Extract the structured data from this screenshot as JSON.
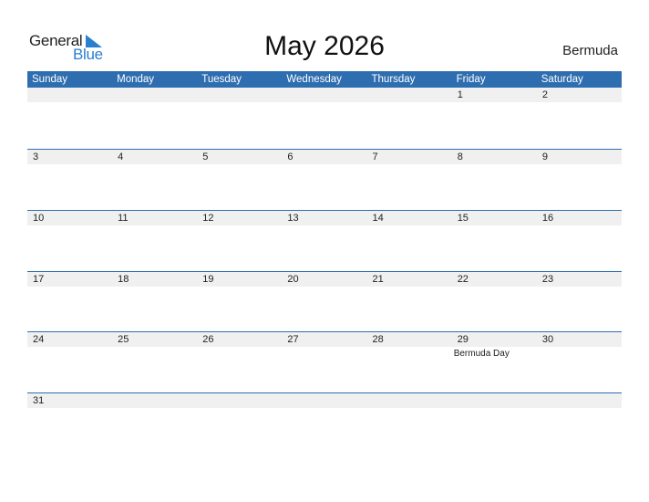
{
  "logo": {
    "line1": "General",
    "line2": "Blue"
  },
  "title": "May 2026",
  "country": "Bermuda",
  "weekdays": [
    "Sunday",
    "Monday",
    "Tuesday",
    "Wednesday",
    "Thursday",
    "Friday",
    "Saturday"
  ],
  "weeks": [
    [
      "",
      "",
      "",
      "",
      "",
      "1",
      "2"
    ],
    [
      "3",
      "4",
      "5",
      "6",
      "7",
      "8",
      "9"
    ],
    [
      "10",
      "11",
      "12",
      "13",
      "14",
      "15",
      "16"
    ],
    [
      "17",
      "18",
      "19",
      "20",
      "21",
      "22",
      "23"
    ],
    [
      "24",
      "25",
      "26",
      "27",
      "28",
      "29",
      "30"
    ],
    [
      "31",
      "",
      "",
      "",
      "",
      "",
      ""
    ]
  ],
  "holidays": {
    "29": "Bermuda Day"
  },
  "colors": {
    "accent": "#2e6eb0",
    "logo_blue": "#2a7fcf",
    "strip": "#f0f0f0"
  }
}
